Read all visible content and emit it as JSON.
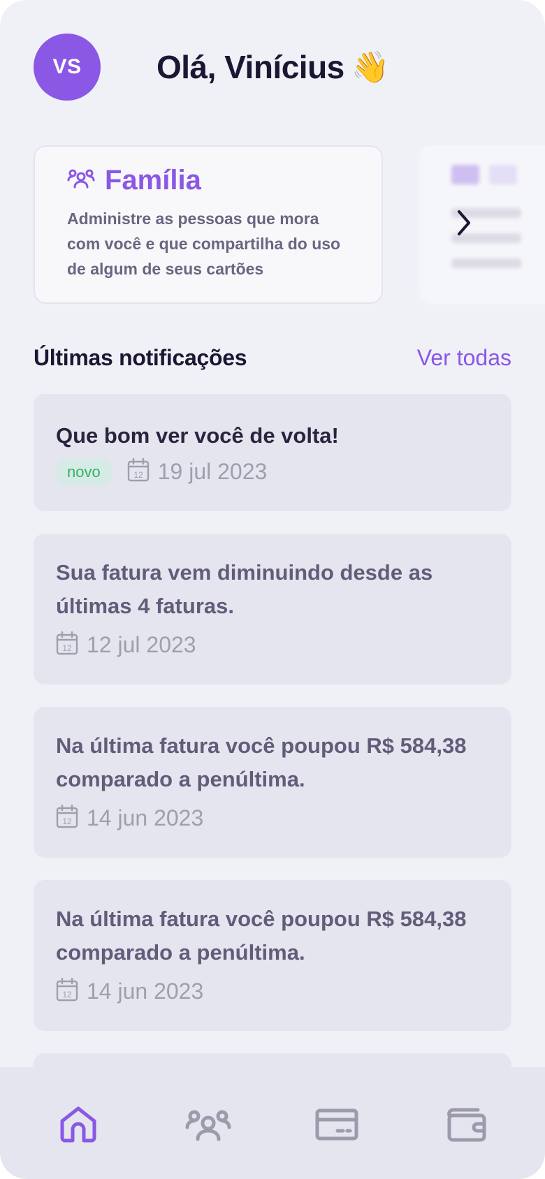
{
  "user": {
    "initials": "VS",
    "greeting": "Olá, Vinícius",
    "wave_emoji": "👋"
  },
  "cards": [
    {
      "title": "Família",
      "icon": "people-icon",
      "description": "Administre as pessoas que mora com você e que compartilha do uso de algum de seus cartões"
    }
  ],
  "notifications_section": {
    "title": "Últimas notificações",
    "see_all": "Ver todas"
  },
  "notifications": [
    {
      "title": "Que bom ver você de volta!",
      "badge": "novo",
      "date": "19 jul 2023"
    },
    {
      "title": "Sua fatura vem diminuindo desde as últimas 4 faturas.",
      "date": "12 jul 2023"
    },
    {
      "title": "Na última fatura você poupou R$ 584,38 comparado a penúltima.",
      "date": "14 jun 2023"
    },
    {
      "title": "Na última fatura você poupou R$ 584,38 comparado a penúltima.",
      "date": "14 jun 2023"
    }
  ],
  "nav": [
    {
      "icon": "home-icon",
      "active": true
    },
    {
      "icon": "people-icon",
      "active": false
    },
    {
      "icon": "card-icon",
      "active": false
    },
    {
      "icon": "wallet-icon",
      "active": false
    }
  ],
  "colors": {
    "accent": "#8b57e5",
    "background": "#f0f1f7",
    "card": "#e5e5ef",
    "badge_bg": "#d6ebe6",
    "badge_text": "#2fb55f",
    "muted": "#a09eae"
  }
}
